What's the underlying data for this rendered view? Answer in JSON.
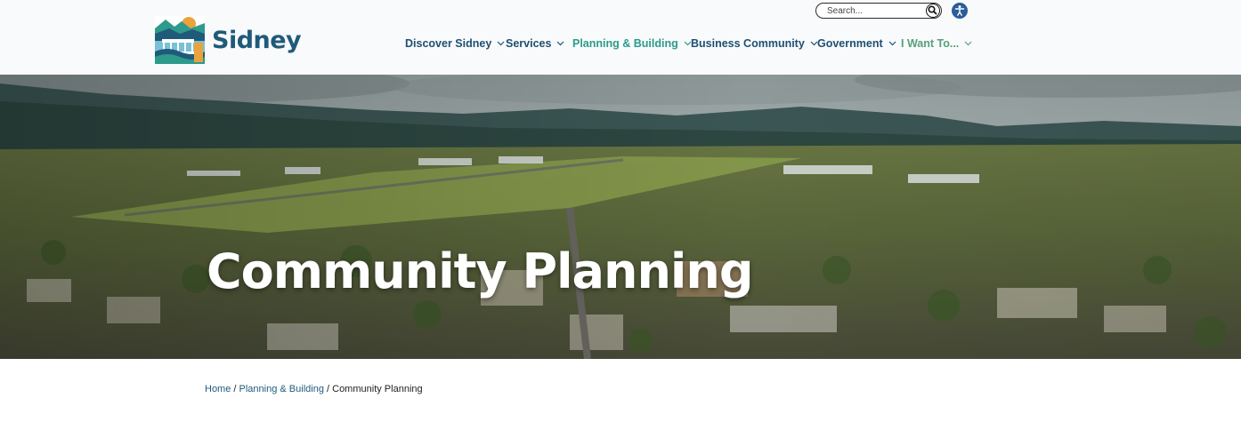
{
  "brand": {
    "name": "Sidney",
    "colors": {
      "primary": "#1f5a7a",
      "nav_text": "#1f4f71",
      "nav_active": "#2c9a8a",
      "nav_want": "#58a07a",
      "accessibility": "#2a5d9a"
    }
  },
  "search": {
    "placeholder": "Search...",
    "icon": "search-icon"
  },
  "accessibility": {
    "icon": "accessibility-icon"
  },
  "nav": {
    "items": [
      {
        "label": "Discover Sidney",
        "icon": "chevron-down-icon"
      },
      {
        "label": "Services",
        "icon": "chevron-down-icon"
      },
      {
        "label": "Planning & Building",
        "icon": "chevron-down-icon",
        "active": true
      },
      {
        "label": "Business Community",
        "icon": "chevron-down-icon"
      },
      {
        "label": "Government",
        "icon": "chevron-down-icon"
      },
      {
        "label": "I Want To...",
        "icon": "chevron-down-icon"
      }
    ]
  },
  "hero": {
    "title": "Community Planning"
  },
  "breadcrumb": {
    "items": [
      {
        "label": "Home"
      },
      {
        "label": "Planning & Building"
      },
      {
        "label": "Community Planning"
      }
    ],
    "separator": "/"
  }
}
